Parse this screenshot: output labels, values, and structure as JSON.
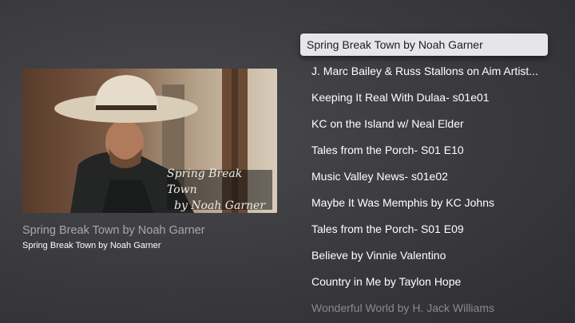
{
  "featured": {
    "title": "Spring Break Town by Noah Garner",
    "subtitle": "Spring Break Town by Noah Garner",
    "thumbnail_caption_line1": "Spring Break Town",
    "thumbnail_caption_line2": "by Noah Garner"
  },
  "episodes": [
    {
      "label": "Spring Break Town by Noah Garner"
    },
    {
      "label": "J. Marc Bailey & Russ Stallons on Aim Artist..."
    },
    {
      "label": "Keeping It Real With Dulaa- s01e01"
    },
    {
      "label": "KC on the Island w/ Neal Elder"
    },
    {
      "label": "Tales from the Porch- S01 E10"
    },
    {
      "label": "Music Valley News- s01e02"
    },
    {
      "label": "Maybe It Was Memphis by KC Johns"
    },
    {
      "label": "Tales from the Porch- S01 E09"
    },
    {
      "label": "Believe by Vinnie Valentino"
    },
    {
      "label": "Country in Me by Taylon Hope"
    },
    {
      "label": "Wonderful World by H. Jack Williams"
    }
  ]
}
